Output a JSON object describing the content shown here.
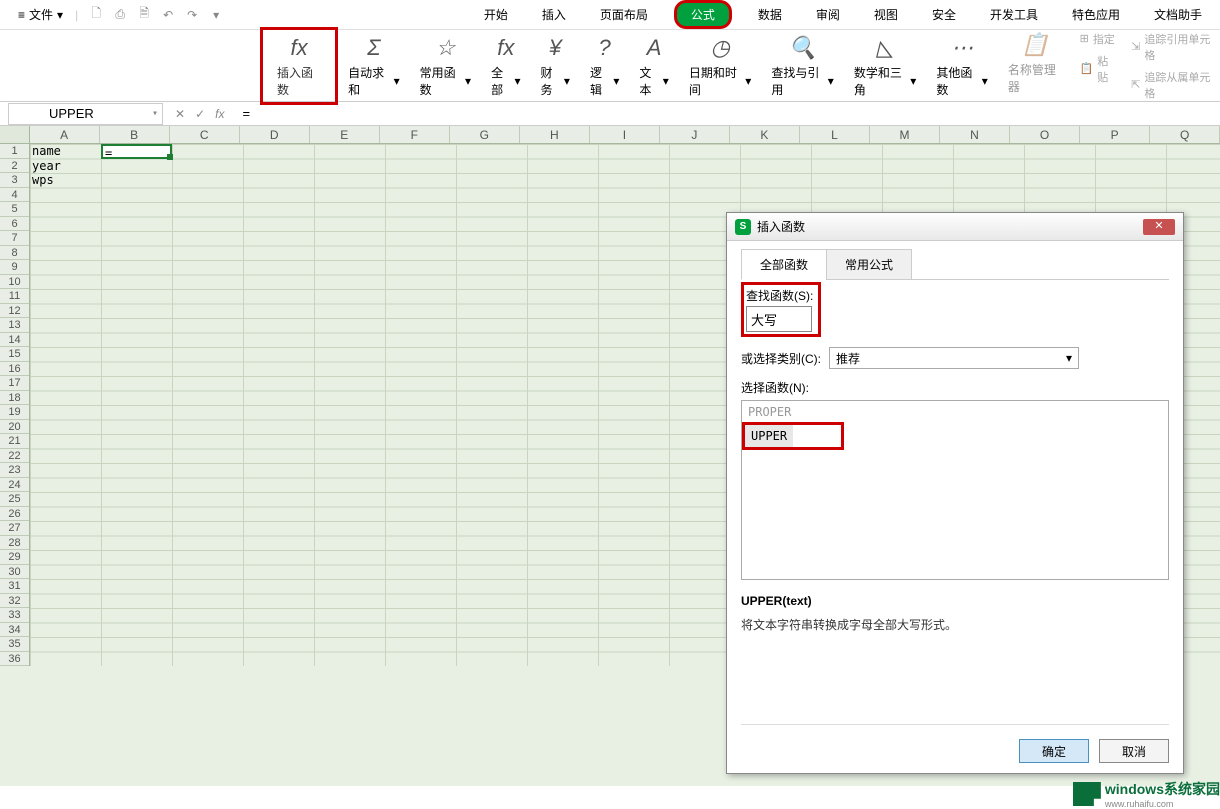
{
  "menu": {
    "file": "文件",
    "tabs": [
      "开始",
      "插入",
      "页面布局",
      "公式",
      "数据",
      "审阅",
      "视图",
      "安全",
      "开发工具",
      "特色应用",
      "文档助手"
    ],
    "active_tab": "公式"
  },
  "ribbon": {
    "insert_fn": "插入函数",
    "auto_sum": "自动求和",
    "common_fn": "常用函数",
    "all": "全部",
    "finance": "财务",
    "logic": "逻辑",
    "text": "文本",
    "date_time": "日期和时间",
    "lookup": "查找与引用",
    "math_trig": "数学和三角",
    "other_fn": "其他函数",
    "name_mgr": "名称管理器",
    "paste": "粘贴",
    "assign": "指定",
    "trace_ref": "追踪引用单元格",
    "trace_dep": "追踪从属单元格"
  },
  "formula_bar": {
    "name_box": "UPPER",
    "formula": "="
  },
  "grid": {
    "cols": [
      "A",
      "B",
      "C",
      "D",
      "E",
      "F",
      "G",
      "H",
      "I",
      "J",
      "K",
      "L",
      "M",
      "N",
      "O",
      "P",
      "Q"
    ],
    "cells": {
      "A1": "name",
      "A2": "year",
      "A3": "wps",
      "B1": "="
    },
    "active_cell": "B1"
  },
  "dialog": {
    "title": "插入函数",
    "tab_all": "全部函数",
    "tab_common": "常用公式",
    "search_label": "查找函数(S):",
    "search_value": "大写",
    "category_label": "或选择类别(C):",
    "category_value": "推荐",
    "select_fn_label": "选择函数(N):",
    "fn_list": [
      "PROPER",
      "UPPER"
    ],
    "fn_selected": "UPPER",
    "fn_signature": "UPPER(text)",
    "fn_desc": "将文本字符串转换成字母全部大写形式。",
    "ok": "确定",
    "cancel": "取消"
  },
  "watermark": {
    "brand": "windows",
    "sub": "www.ruhaifu.com",
    "suffix": "系统家园"
  },
  "chart_data": null
}
